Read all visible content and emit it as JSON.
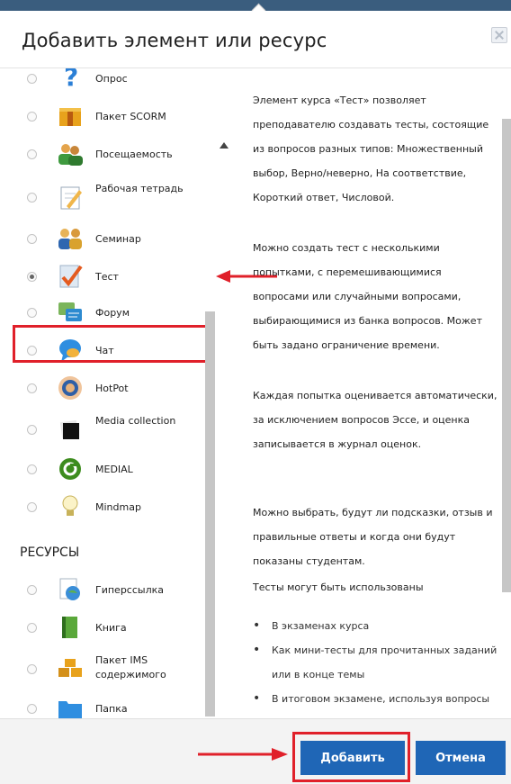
{
  "dialog": {
    "title": "Добавить элемент или ресурс"
  },
  "activities": [
    {
      "label": "Опрос",
      "icon": "question-icon",
      "selected": false
    },
    {
      "label": "Пакет SCORM",
      "icon": "package-box-icon",
      "selected": false
    },
    {
      "label": "Посещаемость",
      "icon": "people-group-icon",
      "selected": false
    },
    {
      "label": "Рабочая тетрадь",
      "icon": "notebook-pen-icon",
      "selected": false
    },
    {
      "label": "Семинар",
      "icon": "seminar-people-icon",
      "selected": false
    },
    {
      "label": "Тест",
      "icon": "checkmark-quiz-icon",
      "selected": true
    },
    {
      "label": "Форум",
      "icon": "forum-bubbles-icon",
      "selected": false
    },
    {
      "label": "Чат",
      "icon": "chat-bubble-icon",
      "selected": false
    },
    {
      "label": "HotPot",
      "icon": "hotpot-hand-icon",
      "selected": false
    },
    {
      "label": "Media collection",
      "icon": "media-collection-icon",
      "selected": false
    },
    {
      "label": "MEDIAL",
      "icon": "medial-logo-icon",
      "selected": false
    },
    {
      "label": "Mindmap",
      "icon": "lightbulb-icon",
      "selected": false
    }
  ],
  "resources_section": "РЕСУРСЫ",
  "resources": [
    {
      "label": "Гиперссылка",
      "icon": "globe-link-icon"
    },
    {
      "label": "Книга",
      "icon": "book-icon"
    },
    {
      "label": "Пакет IMS содержимого",
      "icon": "ims-package-icon"
    },
    {
      "label": "Папка",
      "icon": "folder-icon"
    }
  ],
  "description": {
    "paragraphs": [
      "Элемент курса «Тест» позволяет преподавателю создавать тесты, состоящие из вопросов разных типов: Множественный выбор, Верно/неверно, На соответствие, Короткий ответ, Числовой.",
      "Можно создать тест с несколькими попытками, с перемешивающимися вопросами или случайными вопросами, выбирающимися из банка вопросов. Может быть задано ограничение времени.",
      "Каждая попытка оценивается автоматически, за исключением вопросов Эссе, и оценка записывается в журнал оценок.",
      "Можно выбрать, будут ли подсказки, отзыв и правильные ответы и когда они будут показаны студентам.",
      "Тесты могут быть использованы"
    ],
    "bullets": [
      "В экзаменах курса",
      "Как мини-тесты для прочитанных заданий или в конце темы",
      "В итоговом экзамене, используя вопросы из промежуточных"
    ]
  },
  "footer": {
    "add_label": "Добавить",
    "cancel_label": "Отмена"
  },
  "colors": {
    "primary_button": "#1f66b6",
    "highlight": "#e0202a",
    "header_bar": "#3a5d7e"
  }
}
